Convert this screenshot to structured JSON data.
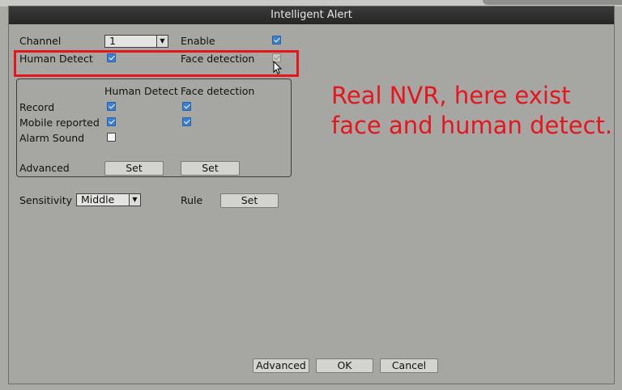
{
  "window": {
    "title": "Intelligent Alert"
  },
  "top": {
    "channel": {
      "label": "Channel",
      "value": "1"
    },
    "enable": {
      "label": "Enable",
      "checked": true
    },
    "human_detect": {
      "label": "Human Detect",
      "checked": true
    },
    "face_detection": {
      "label": "Face detection",
      "checked": true,
      "disabled": true
    }
  },
  "group": {
    "col_headers": [
      "Human Detect",
      "Face detection"
    ],
    "rows": [
      {
        "label": "Record",
        "human": true,
        "face": true
      },
      {
        "label": "Mobile reported",
        "human": true,
        "face": true
      },
      {
        "label": "Alarm Sound",
        "human": false,
        "face": null
      }
    ],
    "advanced": {
      "label": "Advanced",
      "set1": "Set",
      "set2": "Set"
    }
  },
  "sensitivity": {
    "label": "Sensitivity",
    "value": "Middle"
  },
  "rule": {
    "label": "Rule",
    "button": "Set"
  },
  "footer": {
    "advanced": "Advanced",
    "ok": "OK",
    "cancel": "Cancel"
  },
  "annotation": {
    "line1": "Real NVR, here exist",
    "line2": "face and human detect."
  },
  "colors": {
    "highlight": "#e8141b",
    "annotation_text": "#e5161e",
    "checkbox_on": "#3b7fd9"
  }
}
